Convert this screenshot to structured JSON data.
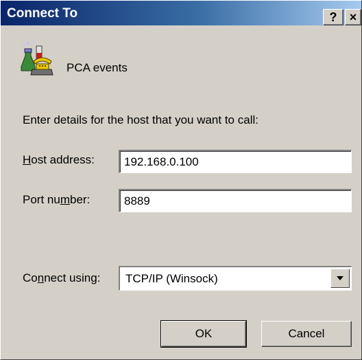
{
  "window": {
    "title": "Connect To",
    "help_label": "?",
    "close_label": "×"
  },
  "connection": {
    "name": "PCA events",
    "instructions": "Enter details for the host that you want to call:"
  },
  "fields": {
    "host_label_pre": "",
    "host_label_mnemonic": "H",
    "host_label_post": "ost address:",
    "host_value": "192.168.0.100",
    "port_label_pre": "Port nu",
    "port_label_mnemonic": "m",
    "port_label_post": "ber:",
    "port_value": "8889",
    "connect_label_pre": "Co",
    "connect_label_mnemonic": "n",
    "connect_label_post": "nect using:",
    "connect_value": "TCP/IP (Winsock)"
  },
  "buttons": {
    "ok": "OK",
    "cancel": "Cancel"
  },
  "icons": {
    "app": "phone-lab-flask-icon",
    "dropdown": "chevron-down-icon"
  }
}
